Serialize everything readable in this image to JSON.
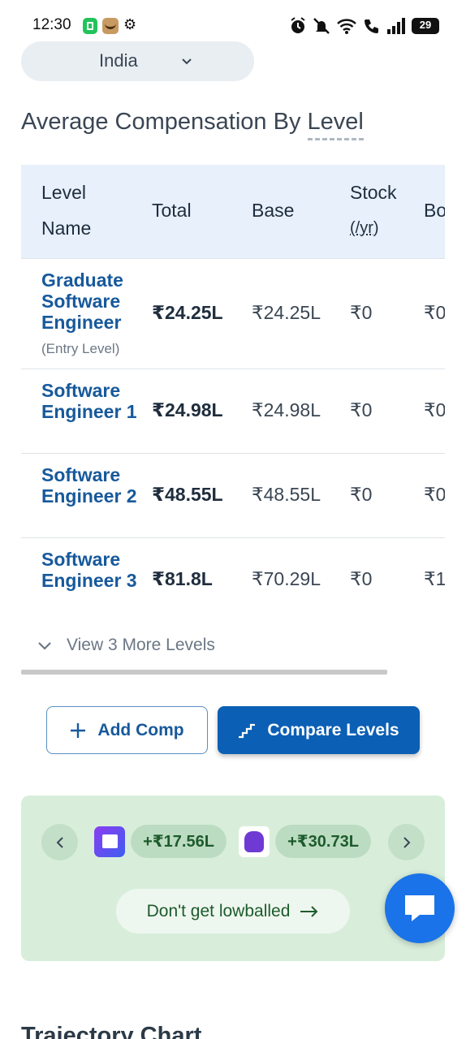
{
  "status_bar": {
    "time": "12:30",
    "battery": "29",
    "icons": [
      "whatsapp-business-icon",
      "app-icon",
      "gear-icon",
      "alarm-icon",
      "mute-icon",
      "wifi-icon",
      "wifi-calling-icon",
      "signal-icon",
      "battery-icon"
    ]
  },
  "country_select": {
    "value": "India"
  },
  "section": {
    "title_prefix": "Average Compensation By",
    "title_link": "Level"
  },
  "table": {
    "headers": {
      "level_name": "Level Name",
      "total": "Total",
      "base": "Base",
      "stock": "Stock",
      "stock_sub": "(/yr)",
      "bonus": "Bo"
    },
    "rows": [
      {
        "name": "Graduate Software Engineer",
        "note": "(Entry Level)",
        "total": "₹24.25L",
        "base": "₹24.25L",
        "stock": "₹0",
        "bonus": "₹0"
      },
      {
        "name": "Software Engineer 1",
        "note": "",
        "total": "₹24.98L",
        "base": "₹24.98L",
        "stock": "₹0",
        "bonus": "₹0"
      },
      {
        "name": "Software Engineer 2",
        "note": "",
        "total": "₹48.55L",
        "base": "₹48.55L",
        "stock": "₹0",
        "bonus": "₹0"
      },
      {
        "name": "Software Engineer 3",
        "note": "",
        "total": "₹81.8L",
        "base": "₹70.29L",
        "stock": "₹0",
        "bonus": "₹1"
      }
    ],
    "view_more": "View 3 More Levels"
  },
  "actions": {
    "add_comp": "Add Comp",
    "compare_levels": "Compare Levels"
  },
  "promo": {
    "offers": [
      "+₹17.56L",
      "+₹30.73L"
    ],
    "cta": "Don't get lowballed"
  },
  "trajectory": {
    "title": "Trajectory Chart"
  },
  "colors": {
    "accent": "#0b5fb5",
    "link": "#17599b",
    "promo_bg": "#d8eedb",
    "fab": "#1a73e8"
  }
}
